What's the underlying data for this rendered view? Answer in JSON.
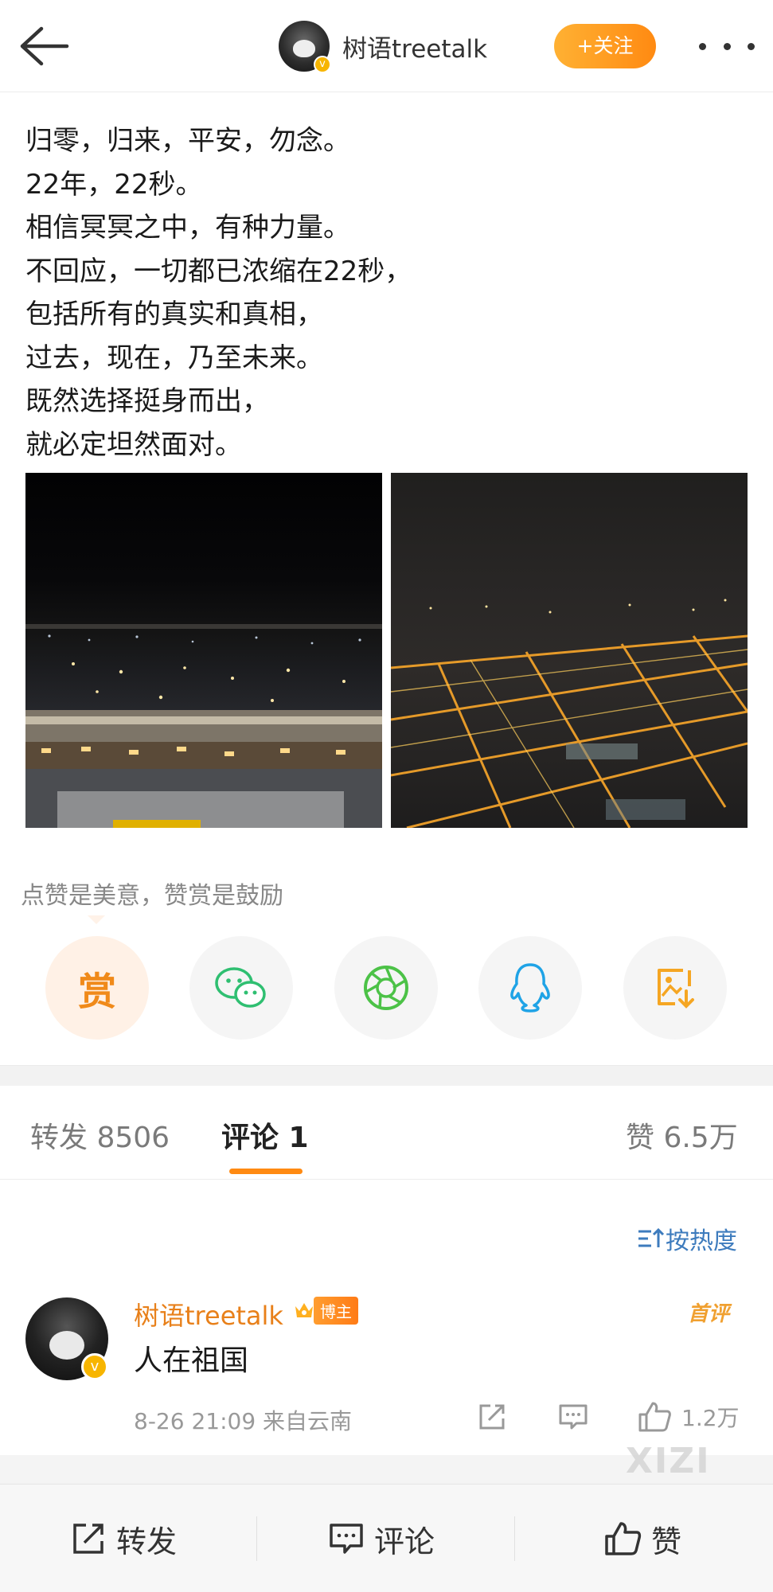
{
  "header": {
    "back_icon": "arrow-left-icon",
    "username": "树语treetalk",
    "verified_icon": "verified-badge-icon",
    "follow_label": "+关注",
    "more_icon": "more-dots-icon"
  },
  "post": {
    "lines": [
      "归零，归来，平安，勿念。",
      "22年，22秒。",
      "相信冥冥之中，有种力量。",
      "不回应，一切都已浓缩在22秒，",
      "包括所有的真实和真相，",
      "过去，现在，乃至未来。",
      "既然选择挺身而出，",
      "就必定坦然面对。"
    ],
    "photos": [
      "night-airport-photo",
      "night-city-aerial-photo"
    ]
  },
  "reward": {
    "hint": "点赞是美意，赞赏是鼓励",
    "reward_label": "赏",
    "share_icons": [
      "wechat-icon",
      "moments-icon",
      "qq-icon",
      "save-image-icon"
    ]
  },
  "tabs": {
    "repost": "转发 8506",
    "comment": "评论 1",
    "like": "赞 6.5万"
  },
  "sort_label": "按热度",
  "comment": {
    "name": "树语treetalk",
    "badge": "博主",
    "first_label": "首评",
    "text": "人在祖国",
    "meta": "8-26 21:09  来自云南",
    "like_count": "1.2万"
  },
  "watermark": "XIZI",
  "bottom_bar": {
    "repost": "转发",
    "comment": "评论",
    "like": "赞"
  },
  "colors": {
    "accent": "#ff8a12",
    "link": "#3d7bbd",
    "name_orange": "#e8801a"
  }
}
